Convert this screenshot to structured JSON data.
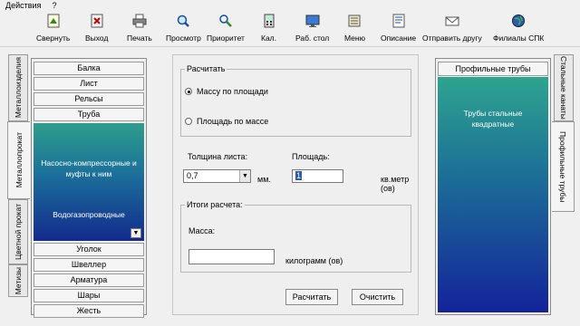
{
  "menu": {
    "actions": "Действия",
    "help": "?"
  },
  "toolbar": [
    {
      "label": "Свернуть",
      "icon": "minimize-icon"
    },
    {
      "label": "Выход",
      "icon": "exit-icon"
    },
    {
      "label": "Печать",
      "icon": "printer-icon"
    },
    {
      "label": "Просмотр",
      "icon": "magnifier-icon"
    },
    {
      "label": "Приоритет",
      "icon": "priority-icon"
    },
    {
      "label": "Кал.",
      "icon": "calculator-icon"
    },
    {
      "label": "Раб. стол",
      "icon": "desktop-icon"
    },
    {
      "label": "Меню",
      "icon": "menu-icon"
    },
    {
      "label": "Описание",
      "icon": "description-icon"
    },
    {
      "label": "Отправить другу",
      "icon": "send-mail-icon"
    },
    {
      "label": "Филиалы СПК",
      "icon": "globe-icon"
    }
  ],
  "left_tabs": [
    "Метизы",
    "Цветной прокат",
    "Металлопрокат",
    "Металлоизделия"
  ],
  "left_list": {
    "top_items": [
      "Балка",
      "Лист",
      "Рельсы",
      "Труба"
    ],
    "selected_title": "Насосно-компрессорные и муфты к ним",
    "selected_sub": "Водогазопроводные",
    "bottom_items": [
      "Уголок",
      "Швеллер",
      "Арматура",
      "Шары",
      "Жесть"
    ]
  },
  "calc": {
    "group_title": "Расчитать",
    "radio_mass": "Массу по площади",
    "radio_area": "Площадь по массе",
    "thickness_label": "Толщина листа:",
    "thickness_value": "0,7",
    "thickness_unit": "мм.",
    "area_label": "Площадь:",
    "area_value": "1",
    "area_unit": "кв.метр (ов)",
    "results_title": "Итоги расчета:",
    "mass_label": "Масса:",
    "mass_value": "",
    "mass_unit": "килограмм (ов)",
    "calc_button": "Расчитать",
    "clear_button": "Очистить"
  },
  "right_panel": {
    "header": "Профильные трубы",
    "content": "Трубы стальные квадратные"
  },
  "right_tabs": [
    "Стальные канаты",
    "Профильные трубы"
  ]
}
